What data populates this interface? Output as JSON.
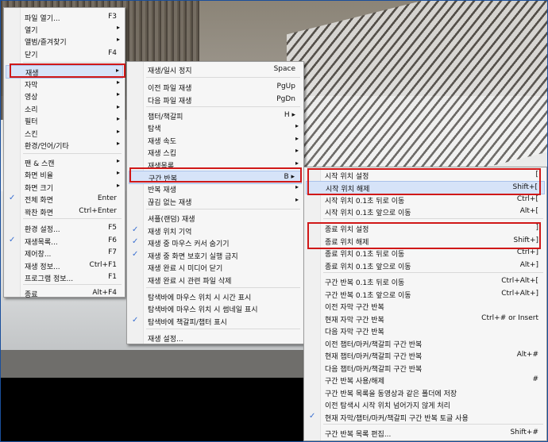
{
  "menu1": {
    "items": [
      {
        "label": "파일 열기...",
        "shortcut": "F3"
      },
      {
        "label": "열기",
        "arrow": "▸"
      },
      {
        "label": "앨범/즐겨찾기",
        "arrow": "▸"
      },
      {
        "label": "닫기",
        "shortcut": "F4"
      },
      {
        "label": "재생",
        "arrow": "▸"
      },
      {
        "label": "자막",
        "arrow": "▸"
      },
      {
        "label": "영상",
        "arrow": "▸"
      },
      {
        "label": "소리",
        "arrow": "▸"
      },
      {
        "label": "필터",
        "arrow": "▸"
      },
      {
        "label": "스킨",
        "arrow": "▸"
      },
      {
        "label": "환경/언어/기타",
        "arrow": "▸"
      },
      {
        "label": "팬 & 스캔",
        "arrow": "▸"
      },
      {
        "label": "화면 비율",
        "arrow": "▸"
      },
      {
        "label": "화면 크기",
        "arrow": "▸"
      },
      {
        "label": "전체 화면",
        "shortcut": "Enter",
        "check": "✓"
      },
      {
        "label": "꽉찬 화면",
        "shortcut": "Ctrl+Enter"
      },
      {
        "label": "환경 설정...",
        "shortcut": "F5"
      },
      {
        "label": "재생목록...",
        "shortcut": "F6",
        "check": "✓"
      },
      {
        "label": "제어창...",
        "shortcut": "F7"
      },
      {
        "label": "재생 정보...",
        "shortcut": "Ctrl+F1"
      },
      {
        "label": "프로그램 정보...",
        "shortcut": "F1"
      },
      {
        "label": "종료",
        "shortcut": "Alt+F4"
      }
    ]
  },
  "menu2": {
    "items": [
      {
        "label": "재생/일시 정지",
        "shortcut": "Space"
      },
      {
        "label": "이전 파일 재생",
        "shortcut": "PgUp"
      },
      {
        "label": "다음 파일 재생",
        "shortcut": "PgDn"
      },
      {
        "label": "챕터/책갈피",
        "shortcut": "H ▸"
      },
      {
        "label": "탐색",
        "arrow": "▸"
      },
      {
        "label": "재생 속도",
        "arrow": "▸"
      },
      {
        "label": "재생 스킵",
        "arrow": "▸"
      },
      {
        "label": "재생목록",
        "arrow": "▸"
      },
      {
        "label": "구간 반복",
        "shortcut": "B ▸"
      },
      {
        "label": "반복 재생",
        "arrow": "▸"
      },
      {
        "label": "끊김 없는 재생",
        "arrow": "▸"
      },
      {
        "label": "셔플(랜덤) 재생"
      },
      {
        "label": "재생 위치 기억",
        "check": "✓"
      },
      {
        "label": "재생 중 마우스 커서 숨기기",
        "check": "✓"
      },
      {
        "label": "재생 중 화면 보호기 실행 금지",
        "check": "✓"
      },
      {
        "label": "재생 완료 시 미디어 닫기"
      },
      {
        "label": "재생 완료 시 관련 파일 삭제"
      },
      {
        "label": "탐색바에 마우스 위치 시 시간 표시"
      },
      {
        "label": "탐색바에 마우스 위치 시 썸네일 표시"
      },
      {
        "label": "탐색바에 책갈피/챕터 표시",
        "check": "✓"
      },
      {
        "label": "재생 설정..."
      }
    ]
  },
  "menu3": {
    "items": [
      {
        "label": "시작 위치 설정",
        "shortcut": "["
      },
      {
        "label": "시작 위치 해제",
        "shortcut": "Shift+["
      },
      {
        "label": "시작 위치 0.1초 뒤로 이동",
        "shortcut": "Ctrl+["
      },
      {
        "label": "시작 위치 0.1초 앞으로 이동",
        "shortcut": "Alt+["
      },
      {
        "label": "종료 위치 설정",
        "shortcut": "]"
      },
      {
        "label": "종료 위치 해제",
        "shortcut": "Shift+]"
      },
      {
        "label": "종료 위치 0.1초 뒤로 이동",
        "shortcut": "Ctrl+]"
      },
      {
        "label": "종료 위치 0.1초 앞으로 이동",
        "shortcut": "Alt+]"
      },
      {
        "label": "구간 반복 0.1초 뒤로 이동",
        "shortcut": "Ctrl+Alt+["
      },
      {
        "label": "구간 반복 0.1초 앞으로 이동",
        "shortcut": "Ctrl+Alt+]"
      },
      {
        "label": "이전 자막 구간 반복"
      },
      {
        "label": "현재 자막 구간 반복",
        "shortcut": "Ctrl+# or Insert"
      },
      {
        "label": "다음 자막 구간 반복"
      },
      {
        "label": "이전 챕터/마커/책갈피 구간 반복"
      },
      {
        "label": "현재 챕터/마커/책갈피 구간 반복",
        "shortcut": "Alt+#"
      },
      {
        "label": "다음 챕터/마커/책갈피 구간 반복"
      },
      {
        "label": "구간 반복 사용/해제",
        "shortcut": "#"
      },
      {
        "label": "구간 반복 목록을 동영상과 같은 폴더에 저장"
      },
      {
        "label": "이전 탐색시 시작 위치 넘어가지 않게 처리"
      },
      {
        "label": "현재 자막/챕터/마커/책갈피 구간 반복 토글 사용",
        "check": "✓"
      },
      {
        "label": "구간 반복 목록 편집...",
        "shortcut": "Shift+#"
      }
    ]
  }
}
